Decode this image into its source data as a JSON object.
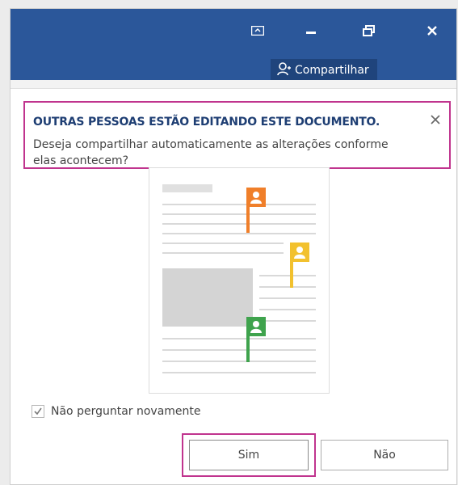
{
  "titlebar": {
    "share_label": "Compartilhar"
  },
  "icons": {
    "restore_ribbon": "ribbon-display-icon",
    "minimize": "minimize-icon",
    "maximize": "restore-window-icon",
    "close": "close-icon",
    "share": "person-share-icon"
  },
  "banner": {
    "title": "OUTRAS PESSOAS ESTÃO EDITANDO ESTE DOCUMENTO.",
    "body": "Deseja compartilhar automaticamente as alterações conforme elas acontecem?"
  },
  "illustration": {
    "flags": [
      {
        "color": "#f07f2a"
      },
      {
        "color": "#f2c12e"
      },
      {
        "color": "#3fa34d"
      }
    ]
  },
  "checkbox": {
    "label": "Não perguntar novamente",
    "checked": true
  },
  "buttons": {
    "yes": "Sim",
    "no": "Não"
  },
  "colors": {
    "titlebar": "#2b579a",
    "highlight": "#c0348e",
    "banner_title": "#1e3e73"
  }
}
